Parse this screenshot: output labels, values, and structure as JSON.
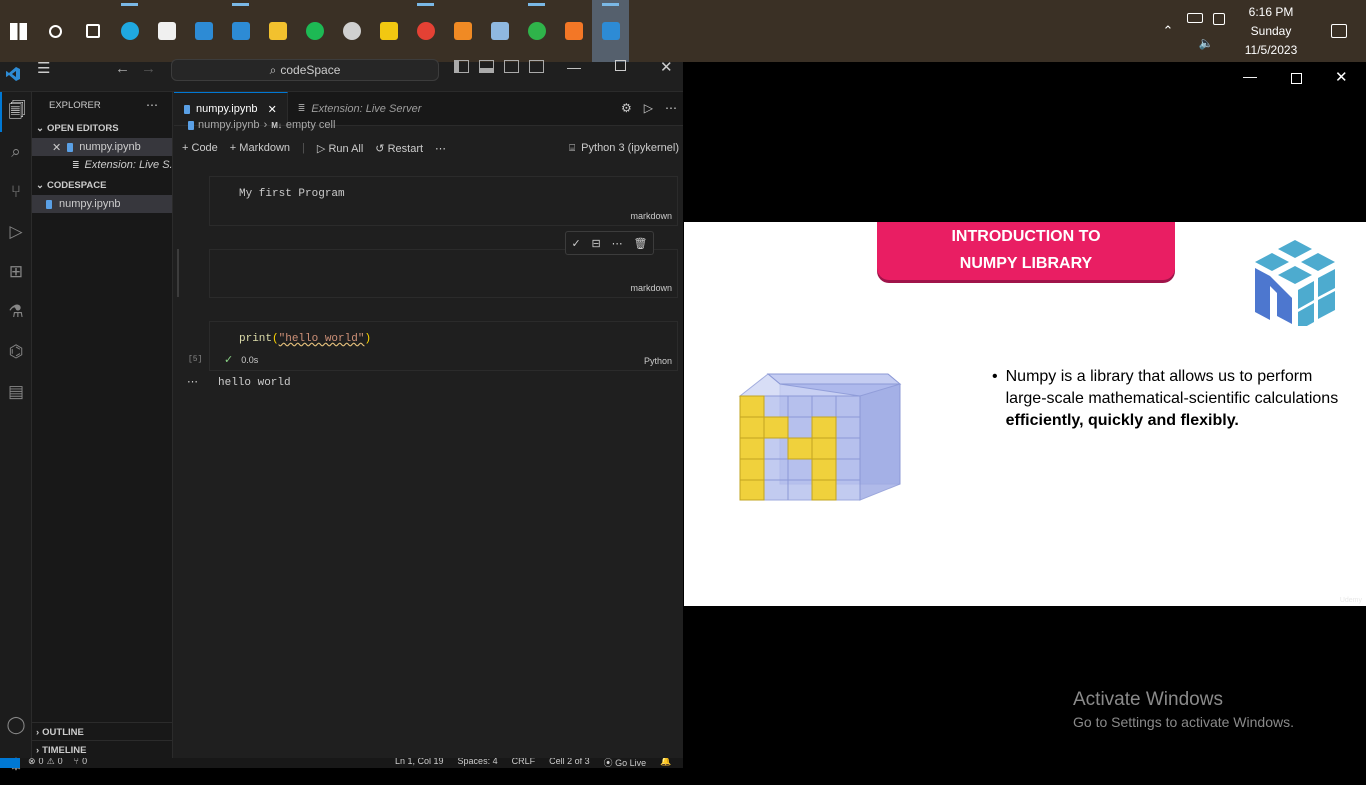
{
  "taskbar": {
    "apps": [
      {
        "icon": "start-icon",
        "color": "#ffffff"
      },
      {
        "icon": "search-icon",
        "color": "#ffffff"
      },
      {
        "icon": "task-view-icon",
        "color": "#ffffff"
      },
      {
        "icon": "edge-icon",
        "color": "#1fa8e0"
      },
      {
        "icon": "store-icon",
        "color": "#f0f0f0"
      },
      {
        "icon": "mail-icon",
        "color": "#2d8bd5"
      },
      {
        "icon": "vscode-icon",
        "color": "#2d8bd5"
      },
      {
        "icon": "file-explorer-icon",
        "color": "#f2c12e"
      },
      {
        "icon": "spotify-icon",
        "color": "#1db954"
      },
      {
        "icon": "media-icon",
        "color": "#d0d0d0"
      },
      {
        "icon": "power-bi-icon",
        "color": "#f2c811"
      },
      {
        "icon": "chrome-icon",
        "color": "#e44134"
      },
      {
        "icon": "vlc-icon",
        "color": "#f08a24"
      },
      {
        "icon": "notepad-icon",
        "color": "#8fb8e0"
      },
      {
        "icon": "ring-app-icon",
        "color": "#2fb34a"
      },
      {
        "icon": "jupyter-icon",
        "color": "#f37726"
      },
      {
        "icon": "video-player-icon",
        "color": "#2d8bd5"
      }
    ],
    "clock": {
      "time": "6:16 PM",
      "day": "Sunday",
      "date": "11/5/2023"
    }
  },
  "vscode": {
    "command_center": "codeSpace",
    "sidebar": {
      "title": "EXPLORER",
      "open_editors_label": "OPEN EDITORS",
      "open_editors": [
        "numpy.ipynb",
        "Extension: Live S..."
      ],
      "folder_label": "CODESPACE",
      "files": [
        "numpy.ipynb"
      ],
      "outline_label": "OUTLINE",
      "timeline_label": "TIMELINE"
    },
    "tabs": [
      {
        "label": "numpy.ipynb"
      },
      {
        "label": "Extension: Live Server"
      }
    ],
    "breadcrumb": {
      "file": "numpy.ipynb",
      "cell": "empty cell",
      "cell_prefix": "M↓"
    },
    "toolbar": {
      "code": "Code",
      "markdown": "Markdown",
      "run_all": "Run All",
      "restart": "Restart",
      "kernel": "Python 3 (ipykernel)"
    },
    "cells": [
      {
        "content": "My first Program",
        "lang": "markdown"
      },
      {
        "content": "",
        "lang": "markdown"
      },
      {
        "code_fn": "print",
        "code_open": "(",
        "code_str": "\"hello world\"",
        "code_close": ")",
        "lang": "Python",
        "exec_count": "[5]",
        "duration": "0.0s",
        "output": "hello world"
      }
    ],
    "status": {
      "problems": "0",
      "warnings": "0",
      "ports": "0",
      "position": "Ln 1, Col 19",
      "spaces": "Spaces: 4",
      "eol": "CRLF",
      "cell": "Cell 2 of 3",
      "golive": "Go Live"
    }
  },
  "slide": {
    "title_line1": "INTRODUCTION TO",
    "title_line2": "NUMPY LIBRARY",
    "bullet_text": "Numpy is a library that allows us to perform large-scale mathematical-scientific calculations ",
    "bullet_bold": "efficiently, quickly and flexibly.",
    "watermark": "Udemy"
  },
  "activation": {
    "title": "Activate Windows",
    "subtitle": "Go to Settings to activate Windows."
  }
}
